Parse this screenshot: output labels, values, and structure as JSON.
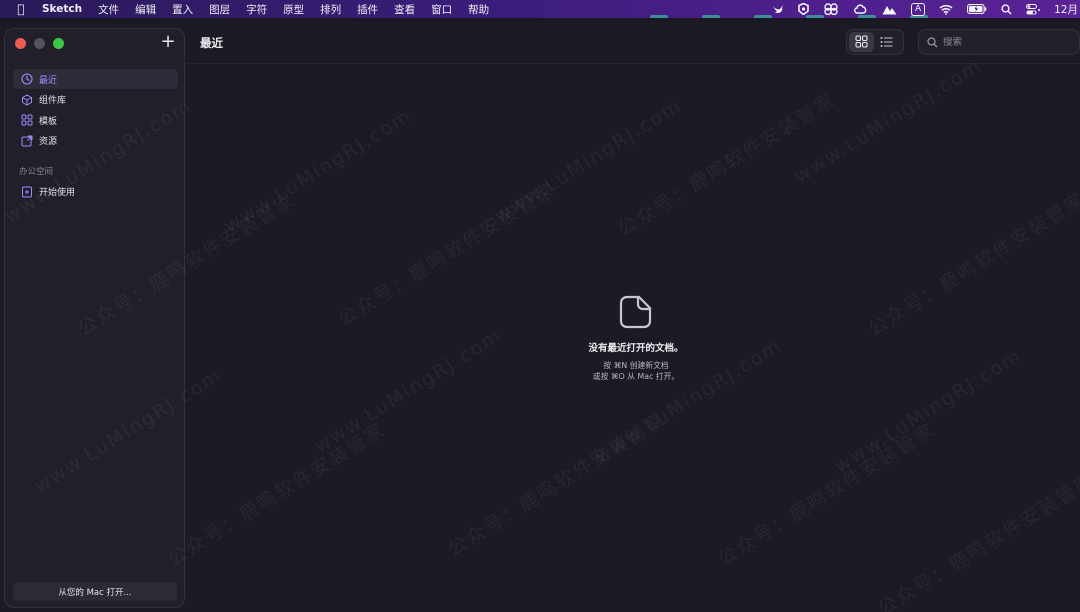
{
  "menubar": {
    "app_name": "Sketch",
    "items": [
      "文件",
      "编辑",
      "置入",
      "图层",
      "字符",
      "原型",
      "排列",
      "插件",
      "查看",
      "窗口",
      "帮助"
    ],
    "input_indicator": "A",
    "clock": "12月"
  },
  "sidebar": {
    "items": [
      {
        "label": "最近",
        "icon": "clock-icon",
        "active": true
      },
      {
        "label": "组件库",
        "icon": "cube-icon",
        "active": false
      },
      {
        "label": "模板",
        "icon": "templates-icon",
        "active": false
      },
      {
        "label": "资源",
        "icon": "resources-icon",
        "active": false
      }
    ],
    "section_title": "办公空间",
    "workspace_items": [
      {
        "label": "开始使用",
        "icon": "start-icon"
      }
    ],
    "open_from_mac": "从您的 Mac 打开..."
  },
  "toolbar": {
    "title": "最近",
    "search_placeholder": "搜索"
  },
  "empty_state": {
    "headline": "没有最近打开的文档。",
    "hint_line1": "按 ⌘N 创建新文档",
    "hint_line2": "或按 ⌘O 从 Mac 打开。"
  },
  "watermark": {
    "text_a": "公众号：鹿鸣软件安装管家",
    "text_b": "www.LuMingRJ.com"
  },
  "colors": {
    "accent": "#9b8cff",
    "close": "#ee5c52",
    "maximize": "#3ec547"
  }
}
